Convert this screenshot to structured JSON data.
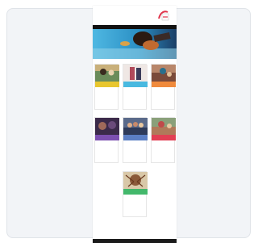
{
  "header": {
    "top_strip": "",
    "title": "",
    "subtitle": ""
  },
  "nav": {
    "items": [
      "",
      "",
      "",
      "",
      ""
    ]
  },
  "sections": [
    {
      "label": "",
      "description": "",
      "band_color": "#e8c62e",
      "img": "a"
    },
    {
      "label": "",
      "description": "",
      "band_color": "#49b9e0",
      "img": "b"
    },
    {
      "label": "",
      "description": "",
      "band_color": "#f08a3c",
      "img": "c"
    },
    {
      "label": "",
      "description": "",
      "band_color": "#7c4fb0",
      "img": "d"
    },
    {
      "label": "",
      "description": "",
      "band_color": "#5b7fc4",
      "img": "e"
    },
    {
      "label": "",
      "description": "",
      "band_color": "#e23f54",
      "img": "f"
    },
    {
      "label": "",
      "description": "",
      "band_color": "#43b86b",
      "img": "g"
    }
  ],
  "footer": {
    "text": ""
  },
  "colors": {
    "background_card": "#f2f4f7",
    "nav_bar": "#111111",
    "hero_accent": "#29a9d9"
  },
  "icons": {
    "logo": "brand-logo-icon"
  }
}
